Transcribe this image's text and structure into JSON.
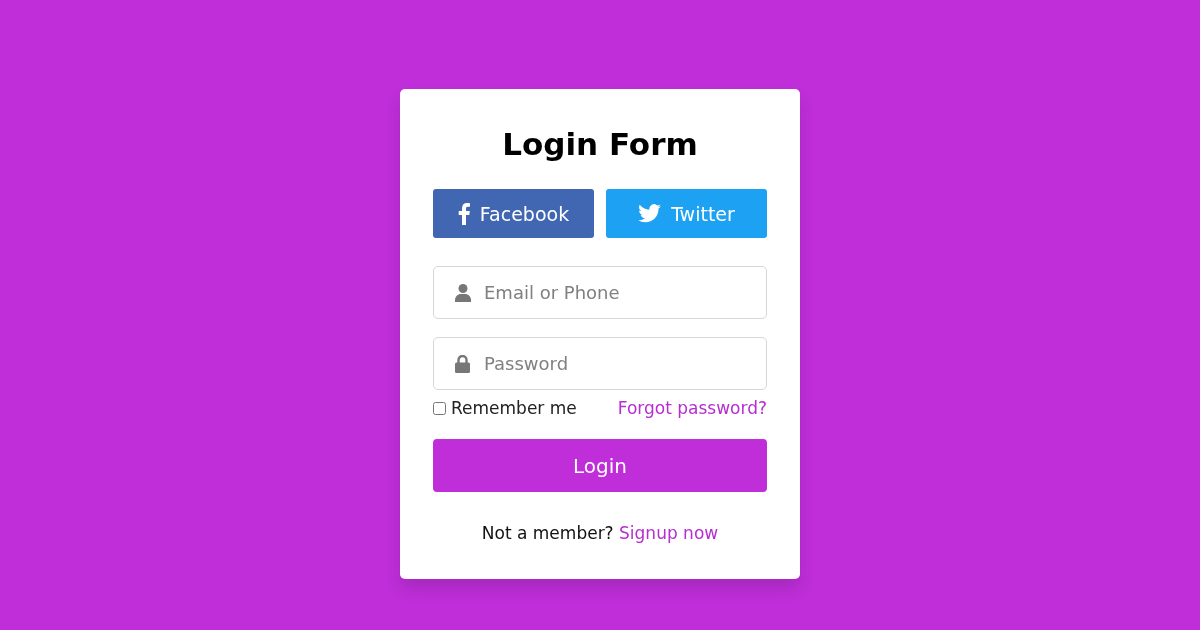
{
  "title": "Login Form",
  "social_buttons": [
    {
      "kind": "facebook",
      "label": "Facebook"
    },
    {
      "kind": "twitter",
      "label": "Twitter"
    }
  ],
  "fields": [
    {
      "kind": "user",
      "placeholder": "Email or Phone"
    },
    {
      "kind": "lock",
      "placeholder": "Password"
    }
  ],
  "remember": {
    "label": "Remember me",
    "checked": false
  },
  "forgot_link": "Forgot password?",
  "login_button": "Login",
  "footer": {
    "text": "Not a member?",
    "link": "Signup now"
  }
}
